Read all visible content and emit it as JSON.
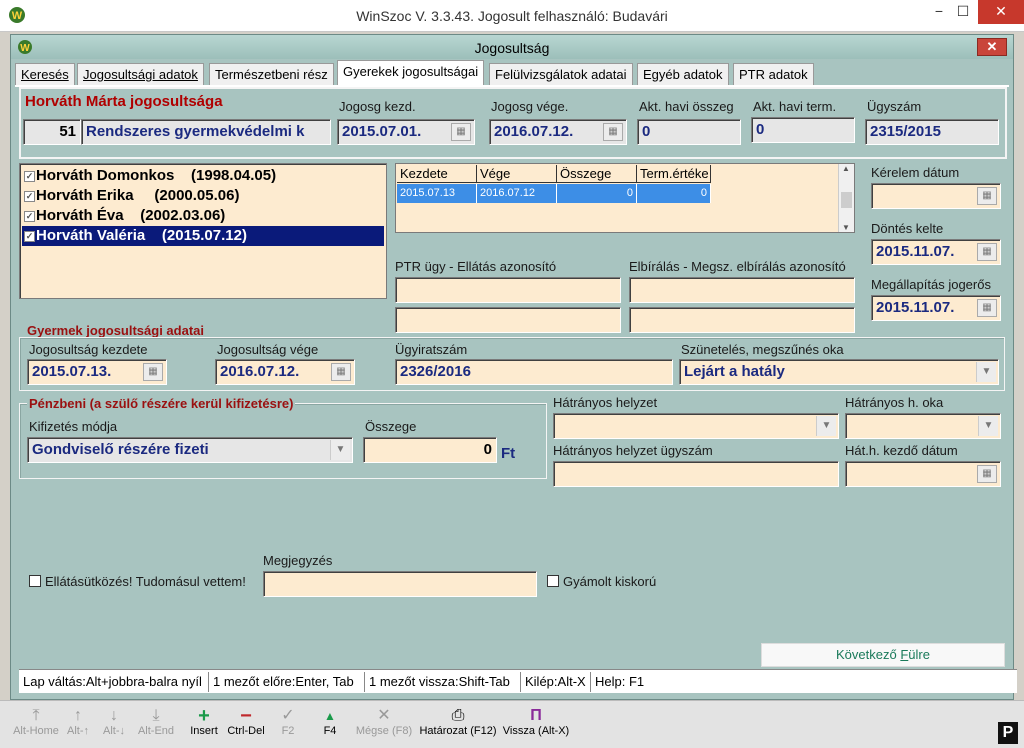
{
  "window": {
    "title": "WinSzoc V. 3.3.43. Jogosult felhasználó: Budavári",
    "min": "−",
    "max": "☐",
    "close": "✕"
  },
  "dialog": {
    "title": "Jogosultság",
    "close": "✕"
  },
  "tabs": [
    {
      "label": "Keresés"
    },
    {
      "label": "Jogosultsági adatok"
    },
    {
      "label": "Természetbeni rész"
    },
    {
      "label": "Gyerekek jogosultságai"
    },
    {
      "label": "Felülvizsgálatok adatai"
    },
    {
      "label": "Egyéb adatok"
    },
    {
      "label": "PTR adatok"
    }
  ],
  "header": {
    "heading": "Horváth Márta jogosultsága",
    "code": "51",
    "type": "Rendszeres gyermekvédelmi k",
    "start_label": "Jogosg kezd.",
    "start": "2015.07.01.",
    "end_label": "Jogosg vége.",
    "end": "2016.07.12.",
    "monthly_label": "Akt. havi összeg",
    "monthly": "0",
    "term_label": "Akt. havi term.",
    "term": "0",
    "case_label": "Ügyszám",
    "case": "2315/2015"
  },
  "children": [
    {
      "name": "Horváth Domonkos",
      "date": "(1998.04.05)"
    },
    {
      "name": "Horváth Erika",
      "date": "(2000.05.06)"
    },
    {
      "name": "Horváth Éva",
      "date": "(2002.03.06)"
    },
    {
      "name": "Horváth Valéria",
      "date": "(2015.07.12)"
    }
  ],
  "grid": {
    "headers": [
      "Kezdete",
      "Vége",
      "Összege",
      "Term.értéke"
    ],
    "row": [
      "2015.07.13",
      "2016.07.12",
      "0",
      "0"
    ]
  },
  "right": {
    "request_label": "Kérelem dátum",
    "request": "",
    "decision_label": "Döntés kelte",
    "decision": "2015.11.07.",
    "final_label": "Megállapítás jogerős",
    "final": "2015.11.07."
  },
  "ptr": {
    "ptr_label": "PTR ügy - Ellátás azonosító",
    "eval_label": "Elbírálás - Megsz. elbírálás azonosító"
  },
  "child_section": {
    "title": "Gyermek jogosultsági adatai",
    "start_label": "Jogosultság kezdete",
    "start": "2015.07.13.",
    "end_label": "Jogosultság vége",
    "end": "2016.07.12.",
    "file_label": "Ügyiratszám",
    "file": "2326/2016",
    "reason_label": "Szünetelés, megszűnés oka",
    "reason": "Lejárt a hatály"
  },
  "money": {
    "title": "Pénzbeni (a szülő részére kerül kifizetésre)",
    "method_label": "Kifizetés módja",
    "method": "Gondviselő részére fizeti",
    "amount_label": "Összege",
    "amount": "0",
    "currency": "Ft"
  },
  "disadv": {
    "label": "Hátrányos helyzet",
    "reason_label": "Hátrányos h. oka",
    "file_label": "Hátrányos helyzet ügyszám",
    "start_label": "Hát.h. kezdő dátum"
  },
  "bottom": {
    "conflict_label": "Ellátásütközés! Tudomásul vettem!",
    "note_label": "Megjegyzés",
    "ward_label": "Gyámolt kiskorú",
    "next_prefix": "Következő ",
    "next_u": "F",
    "next_suffix": "ülre"
  },
  "status": [
    "Lap váltás:Alt+jobbra-balra nyíl",
    "1 mezőt előre:Enter, Tab",
    "1 mezőt vissza:Shift-Tab",
    "Kilép:Alt-X",
    "Help: F1"
  ],
  "toolbar": [
    {
      "label": "Alt-Home",
      "icon": "⤒"
    },
    {
      "label": "Alt-↑",
      "icon": "↑"
    },
    {
      "label": "Alt-↓",
      "icon": "↓"
    },
    {
      "label": "Alt-End",
      "icon": "⤓"
    },
    {
      "label": "Insert",
      "icon": "+"
    },
    {
      "label": "Ctrl-Del",
      "icon": "−"
    },
    {
      "label": "F2",
      "icon": "✓"
    },
    {
      "label": "F4",
      "icon": "▲"
    },
    {
      "label": "Mégse (F8)",
      "icon": "✕"
    },
    {
      "label": "Határozat (F12)",
      "icon": "⎙"
    },
    {
      "label": "Vissza (Alt-X)",
      "icon": "Π"
    }
  ],
  "badge": "P"
}
